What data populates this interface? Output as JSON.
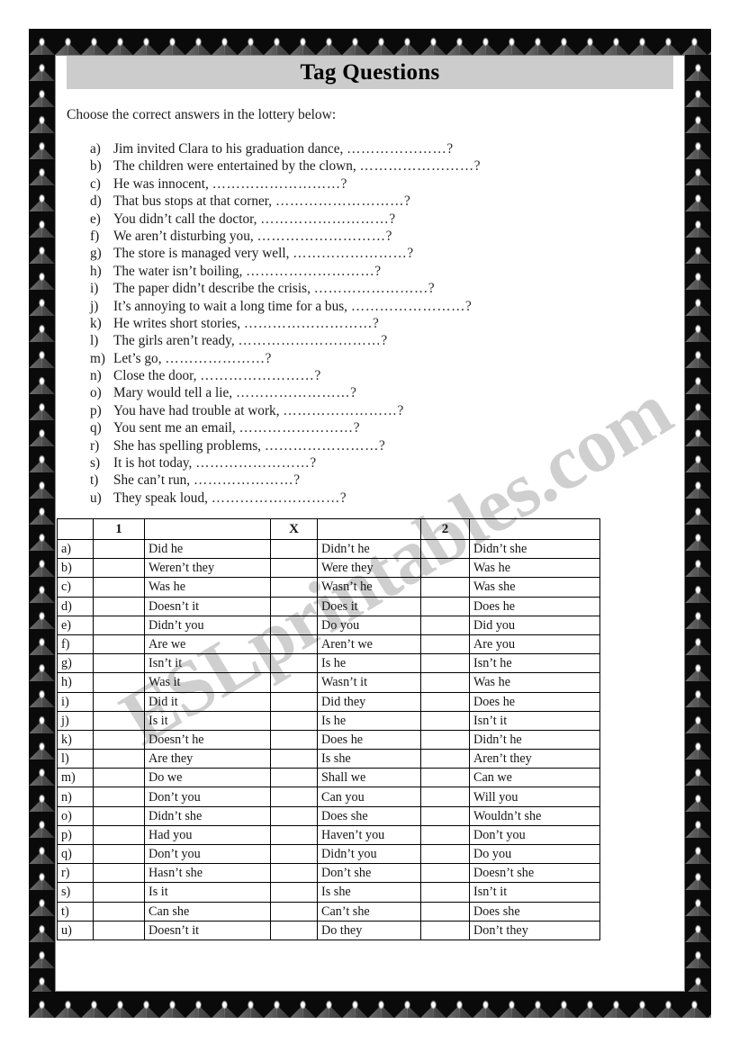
{
  "title": "Tag Questions",
  "instruction": "Choose the correct answers in the lottery below:",
  "watermark": "ESLprintables.com",
  "colors": {
    "banner_gray": "#cccccc",
    "watermark_gray": "#cfcfcf",
    "text_black": "#1a1a1a",
    "table_border": "#000000"
  },
  "questions": [
    {
      "letter": "a)",
      "text": "Jim invited Clara to his graduation dance,",
      "dots": "…………………?"
    },
    {
      "letter": "b)",
      "text": "The children were entertained by the clown,",
      "dots": "……………………?"
    },
    {
      "letter": "c)",
      "text": "He was innocent,",
      "dots": "………………………?"
    },
    {
      "letter": "d)",
      "text": "That bus stops at that corner,",
      "dots": "………………………?"
    },
    {
      "letter": "e)",
      "text": "You didn’t call the doctor,",
      "dots": "………………………?"
    },
    {
      "letter": "f)",
      "text": "We aren’t disturbing you,",
      "dots": "………………………?"
    },
    {
      "letter": "g)",
      "text": "The store is managed very well,",
      "dots": "……………………?"
    },
    {
      "letter": "h)",
      "text": "The water isn’t boiling,",
      "dots": "………………………?"
    },
    {
      "letter": "i)",
      "text": "The paper didn’t describe the crisis,",
      "dots": "……………………?"
    },
    {
      "letter": "j)",
      "text": "It’s annoying to wait a long time for a bus,",
      "dots": "……………………?"
    },
    {
      "letter": "k)",
      "text": "He writes short stories,",
      "dots": "………………………?"
    },
    {
      "letter": "l)",
      "text": "The girls aren’t ready,",
      "dots": "…………………………?"
    },
    {
      "letter": "m)",
      "text": "Let’s go,",
      "dots": "…………………?"
    },
    {
      "letter": "n)",
      "text": "Close the door,",
      "dots": "……………………?"
    },
    {
      "letter": "o)",
      "text": "Mary would tell a lie,",
      "dots": "……………………?"
    },
    {
      "letter": "p)",
      "text": "You have had trouble at work,",
      "dots": "……………………?"
    },
    {
      "letter": "q)",
      "text": "You sent me an email,",
      "dots": "……………………?"
    },
    {
      "letter": "r)",
      "text": "She has spelling problems,",
      "dots": "……………………?"
    },
    {
      "letter": "s)",
      "text": "It is hot today,",
      "dots": "……………………?"
    },
    {
      "letter": "t)",
      "text": "She can’t run,",
      "dots": "…………………?"
    },
    {
      "letter": "u)",
      "text": "They speak loud,",
      "dots": "………………………?"
    }
  ],
  "table": {
    "headers": {
      "letter": "",
      "col1": "1",
      "opt1": "",
      "colX": "X",
      "opt2": "",
      "col2": "2",
      "opt3": ""
    },
    "rows": [
      {
        "letter": "a)",
        "opt1": "Did he",
        "opt2": "Didn’t he",
        "opt3": "Didn’t she"
      },
      {
        "letter": "b)",
        "opt1": "Weren’t they",
        "opt2": "Were they",
        "opt3": "Was he"
      },
      {
        "letter": "c)",
        "opt1": "Was he",
        "opt2": "Wasn’t he",
        "opt3": "Was she"
      },
      {
        "letter": "d)",
        "opt1": "Doesn’t it",
        "opt2": "Does it",
        "opt3": "Does he"
      },
      {
        "letter": "e)",
        "opt1": "Didn’t you",
        "opt2": "Do you",
        "opt3": "Did you"
      },
      {
        "letter": "f)",
        "opt1": "Are we",
        "opt2": "Aren’t we",
        "opt3": "Are you"
      },
      {
        "letter": "g)",
        "opt1": "Isn’t it",
        "opt2": "Is he",
        "opt3": "Isn’t he"
      },
      {
        "letter": "h)",
        "opt1": "Was it",
        "opt2": "Wasn’t it",
        "opt3": "Was he"
      },
      {
        "letter": "i)",
        "opt1": "Did it",
        "opt2": "Did they",
        "opt3": "Does he"
      },
      {
        "letter": "j)",
        "opt1": "Is it",
        "opt2": "Is he",
        "opt3": "Isn’t it"
      },
      {
        "letter": "k)",
        "opt1": "Doesn’t he",
        "opt2": "Does he",
        "opt3": "Didn’t he"
      },
      {
        "letter": "l)",
        "opt1": "Are they",
        "opt2": "Is she",
        "opt3": "Aren’t they"
      },
      {
        "letter": "m)",
        "opt1": "Do we",
        "opt2": "Shall we",
        "opt3": "Can we"
      },
      {
        "letter": "n)",
        "opt1": "Don’t you",
        "opt2": "Can you",
        "opt3": "Will you"
      },
      {
        "letter": "o)",
        "opt1": "Didn’t she",
        "opt2": "Does she",
        "opt3": "Wouldn’t she"
      },
      {
        "letter": "p)",
        "opt1": "Had you",
        "opt2": "Haven’t you",
        "opt3": "Don’t you"
      },
      {
        "letter": "q)",
        "opt1": "Don’t you",
        "opt2": "Didn’t you",
        "opt3": "Do you"
      },
      {
        "letter": "r)",
        "opt1": "Hasn’t she",
        "opt2": "Don’t she",
        "opt3": "Doesn’t she"
      },
      {
        "letter": "s)",
        "opt1": "Is it",
        "opt2": "Is she",
        "opt3": "Isn’t it"
      },
      {
        "letter": "t)",
        "opt1": "Can she",
        "opt2": "Can’t she",
        "opt3": "Does she"
      },
      {
        "letter": "u)",
        "opt1": "Doesn’t it",
        "opt2": "Do they",
        "opt3": "Don’t they"
      }
    ]
  }
}
